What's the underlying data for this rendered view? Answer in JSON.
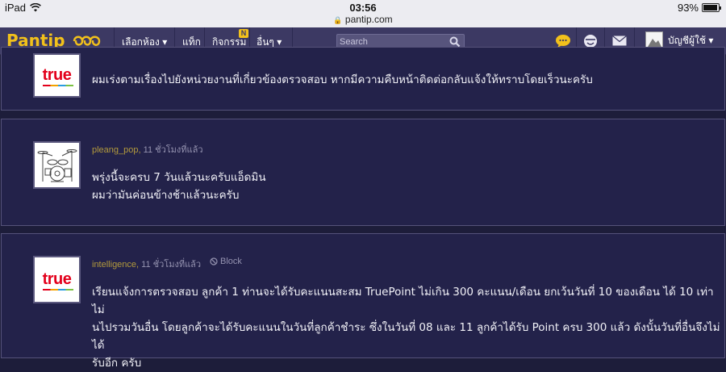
{
  "status_bar": {
    "device": "iPad",
    "time": "03:56",
    "url": "pantip.com",
    "battery": "93%",
    "battery_level": 0.93
  },
  "nav": {
    "logo": "Pantip",
    "items": [
      "เลือกห้อง ▾",
      "แท็ก",
      "กิจกรรม",
      "อื่นๆ ▾"
    ],
    "badge": "N",
    "search_placeholder": "Search",
    "account_label": "บัญชีผู้ใช้ ▾"
  },
  "posts": [
    {
      "author": "",
      "time": "",
      "avatar": "true-logo",
      "body_lines": [
        "ผมเร่งตามเรื่องไปยังหน่วยงานที่เกี่ยวข้องตรวจสอบ หากมีความคืบหน้าติดต่อกลับแจ้งให้ทราบโดยเร็วนะครับ"
      ]
    },
    {
      "author": "pleang_pop",
      "time": "11 ชั่วโมงที่แล้ว",
      "avatar": "drum-kit",
      "body_lines": [
        "พรุ่งนี้จะครบ 7 วันแล้วนะครับแอ็ดมิน",
        "ผมว่ามันค่อนข้างช้าแล้วนะครับ"
      ]
    },
    {
      "author": "intelligence",
      "time": "11 ชั่วโมงที่แล้ว",
      "block_label": "Block",
      "avatar": "true-logo",
      "body_lines": [
        "เรียนแจ้งการตรวจสอบ ลูกค้า 1 ท่านจะได้รับคะแนนสะสม TruePoint ไม่เกิน 300 คะแนน/เดือน ยกเว้นวันที่ 10 ของเดือน ได้ 10 เท่า ไม่",
        "นไปรวมวันอื่น โดยลูกค้าจะได้รับคะแนนในวันที่ลูกค้าชำระ ซึ่งในวันที่ 08 และ 11 ลูกค้าได้รับ Point ครบ 300 แล้ว ดังนั้นวันที่อื่นจึงไม่ได้",
        "รับอีก ครับ"
      ]
    }
  ],
  "true_logo_text": "true"
}
